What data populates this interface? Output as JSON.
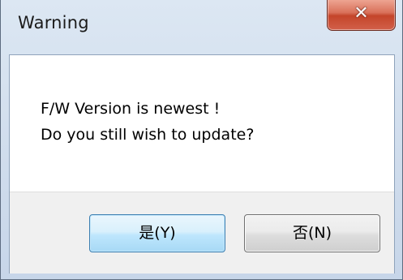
{
  "window": {
    "title": "Warning",
    "close_glyph": "✕",
    "close_icon": "close-icon"
  },
  "message": {
    "line1": "F/W Version is newest !",
    "line2": "Do you still wish to update?"
  },
  "buttons": {
    "yes_label": "是(Y)",
    "no_label": "否(N)"
  },
  "colors": {
    "close_button": "#c4452a",
    "default_button_border": "#3c7fb1"
  }
}
